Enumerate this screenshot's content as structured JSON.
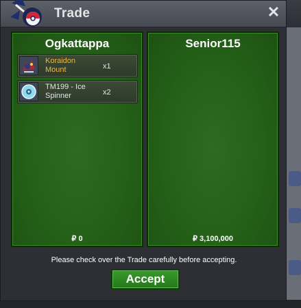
{
  "window": {
    "title": "Trade",
    "close_label": "✕"
  },
  "left_panel": {
    "player": "Ogkattappa",
    "items": [
      {
        "name": "Koraidon Mount",
        "qty": "x1",
        "name_color": "#e8b84a",
        "icon": "koraidon-mount-icon"
      },
      {
        "name": "TM199 - Ice Spinner",
        "qty": "x2",
        "name_color": "#e5e5e5",
        "icon": "disc-icon"
      }
    ],
    "money": "₽ 0"
  },
  "right_panel": {
    "player": "Senior115",
    "items": [],
    "money": "₽ 3,100,000"
  },
  "notice": "Please check over the Trade carefully before accepting.",
  "accept_label": "Accept"
}
